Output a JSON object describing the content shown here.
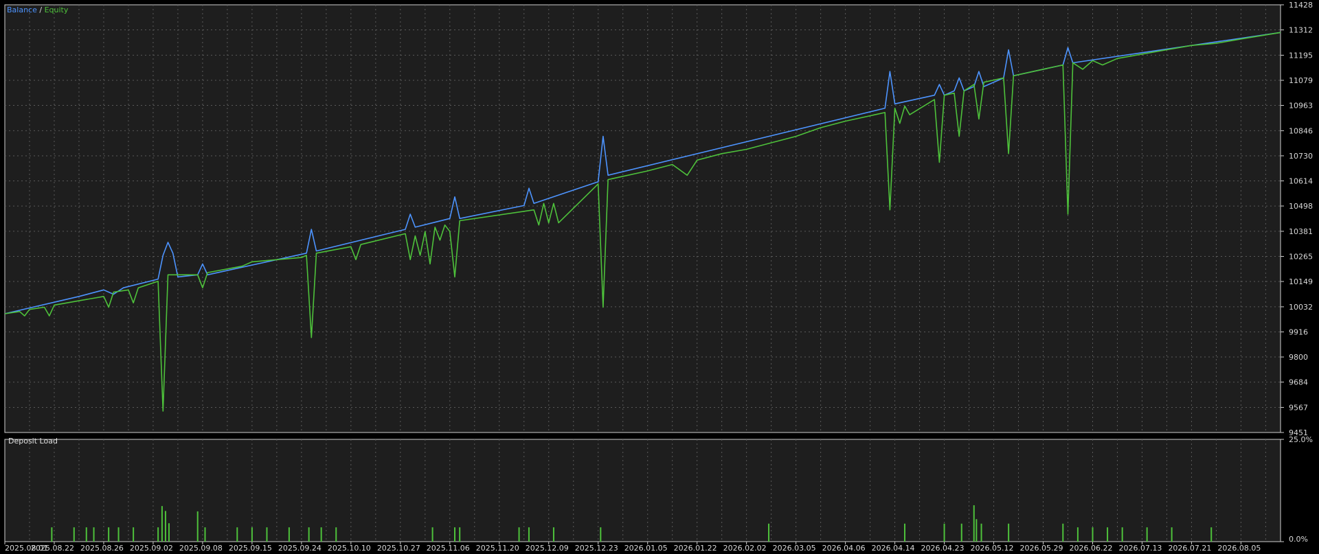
{
  "chart_data": [
    {
      "type": "line",
      "legend": {
        "balance_label": "Balance",
        "separator": " / ",
        "equity_label": "Equity",
        "placement": "top-left"
      },
      "colors": {
        "balance": "#4d94ff",
        "equity": "#4ec23b",
        "grid": "#5a5a5a",
        "background": "#1e1e1e",
        "frame": "#d0d0d0"
      },
      "grid": true,
      "ylim": [
        9451,
        11428
      ],
      "y_ticks": [
        11428,
        11312,
        11195,
        11079,
        10963,
        10846,
        10730,
        10614,
        10498,
        10381,
        10265,
        10149,
        10032,
        9916,
        9800,
        9684,
        9567,
        9451
      ],
      "x_ticks": [
        "2025.08.01",
        "2025.08.22",
        "2025.08.26",
        "2025.09.02",
        "2025.09.08",
        "2025.09.15",
        "2025.09.24",
        "2025.10.10",
        "2025.10.27",
        "2025.11.06",
        "2025.11.20",
        "2025.12.09",
        "2025.12.23",
        "2026.01.05",
        "2026.01.22",
        "2026.02.02",
        "2026.03.05",
        "2026.04.06",
        "2026.04.14",
        "2026.04.23",
        "2026.05.12",
        "2026.05.29",
        "2026.06.22",
        "2026.07.13",
        "2026.07.21",
        "2026.08.05"
      ],
      "x_range": [
        0,
        25.8
      ],
      "series": [
        {
          "name": "Balance",
          "x": [
            0,
            1.5,
            2.0,
            2.2,
            2.4,
            3.1,
            3.2,
            3.3,
            3.4,
            3.5,
            3.9,
            4.0,
            4.1,
            6.1,
            6.2,
            6.3,
            8.1,
            8.2,
            8.3,
            9.0,
            9.1,
            9.2,
            10.5,
            10.6,
            10.7,
            12.0,
            12.1,
            12.2,
            17.8,
            17.9,
            18.0,
            18.8,
            18.9,
            19.0,
            19.2,
            19.3,
            19.4,
            19.6,
            19.7,
            19.8,
            20.2,
            20.3,
            20.4,
            21.4,
            21.5,
            21.6,
            25.8
          ],
          "y": [
            10000,
            10080,
            10110,
            10090,
            10120,
            10160,
            10270,
            10330,
            10280,
            10170,
            10180,
            10230,
            10180,
            10280,
            10390,
            10290,
            10390,
            10460,
            10400,
            10440,
            10540,
            10440,
            10500,
            10580,
            10510,
            10610,
            10820,
            10640,
            10950,
            11120,
            10970,
            11010,
            11060,
            11010,
            11030,
            11090,
            11030,
            11050,
            11120,
            11050,
            11090,
            11220,
            11100,
            11150,
            11230,
            11160,
            11300
          ]
        },
        {
          "name": "Equity",
          "x": [
            0,
            0.3,
            0.4,
            0.5,
            0.8,
            0.9,
            1.0,
            1.5,
            2.0,
            2.1,
            2.2,
            2.5,
            2.6,
            2.7,
            3.1,
            3.2,
            3.3,
            3.9,
            4.0,
            4.1,
            4.8,
            5.0,
            6.0,
            6.1,
            6.2,
            6.3,
            7.0,
            7.1,
            7.2,
            8.1,
            8.2,
            8.3,
            8.4,
            8.5,
            8.6,
            8.7,
            8.8,
            8.9,
            9.0,
            9.1,
            9.2,
            10.7,
            10.8,
            10.9,
            11.0,
            11.1,
            11.2,
            12.0,
            12.1,
            12.2,
            13.0,
            13.5,
            13.8,
            14.0,
            14.5,
            15.0,
            15.5,
            16.0,
            16.5,
            17.0,
            17.8,
            17.9,
            18.0,
            18.1,
            18.2,
            18.3,
            18.8,
            18.9,
            19.0,
            19.2,
            19.3,
            19.4,
            19.6,
            19.7,
            19.8,
            20.2,
            20.3,
            20.4,
            21.4,
            21.5,
            21.6,
            21.8,
            22.0,
            22.2,
            22.5,
            23.0,
            23.5,
            24.0,
            24.5,
            25.0,
            25.8
          ],
          "y": [
            10000,
            10010,
            9990,
            10020,
            10030,
            9990,
            10040,
            10060,
            10080,
            10030,
            10100,
            10110,
            10050,
            10120,
            10150,
            9550,
            10180,
            10180,
            10120,
            10190,
            10220,
            10240,
            10260,
            10270,
            9890,
            10280,
            10310,
            10250,
            10320,
            10370,
            10250,
            10360,
            10270,
            10380,
            10230,
            10400,
            10340,
            10410,
            10380,
            10170,
            10430,
            10480,
            10410,
            10510,
            10420,
            10510,
            10420,
            10600,
            10030,
            10620,
            10660,
            10690,
            10640,
            10710,
            10740,
            10760,
            10790,
            10820,
            10860,
            10890,
            10930,
            10480,
            10950,
            10880,
            10960,
            10920,
            10990,
            10700,
            11010,
            11020,
            10820,
            11030,
            11060,
            10900,
            11070,
            11090,
            10740,
            11100,
            11150,
            10460,
            11160,
            11130,
            11170,
            11150,
            11180,
            11200,
            11220,
            11240,
            11250,
            11270,
            11300
          ]
        }
      ]
    },
    {
      "type": "bar",
      "title": "Deposit Load",
      "ylim": [
        0,
        25
      ],
      "y_ticks": [
        "25.0%",
        "0.0%"
      ],
      "colors": {
        "bar": "#4ec23b"
      },
      "x": [
        0.95,
        1.4,
        1.65,
        1.8,
        2.1,
        2.3,
        2.6,
        3.1,
        3.18,
        3.25,
        3.32,
        3.9,
        4.05,
        4.7,
        5.0,
        5.3,
        5.75,
        6.15,
        6.4,
        6.7,
        8.65,
        9.1,
        9.2,
        10.4,
        10.6,
        11.1,
        12.05,
        15.45,
        18.2,
        19.0,
        19.35,
        19.6,
        19.65,
        19.75,
        20.3,
        21.4,
        21.7,
        22.0,
        22.3,
        22.6,
        23.1,
        23.6,
        24.4
      ],
      "values": [
        3.5,
        3.5,
        3.5,
        3.5,
        3.5,
        3.5,
        3.5,
        3.5,
        8.7,
        7.5,
        4.5,
        7.4,
        3.5,
        3.5,
        3.5,
        3.5,
        3.5,
        3.5,
        3.5,
        3.5,
        3.5,
        3.5,
        3.5,
        3.5,
        3.5,
        3.5,
        3.5,
        4.4,
        4.4,
        4.4,
        4.4,
        8.9,
        5.5,
        4.4,
        4.4,
        4.4,
        3.5,
        3.5,
        3.5,
        3.5,
        3.5,
        3.5,
        3.5
      ]
    }
  ]
}
